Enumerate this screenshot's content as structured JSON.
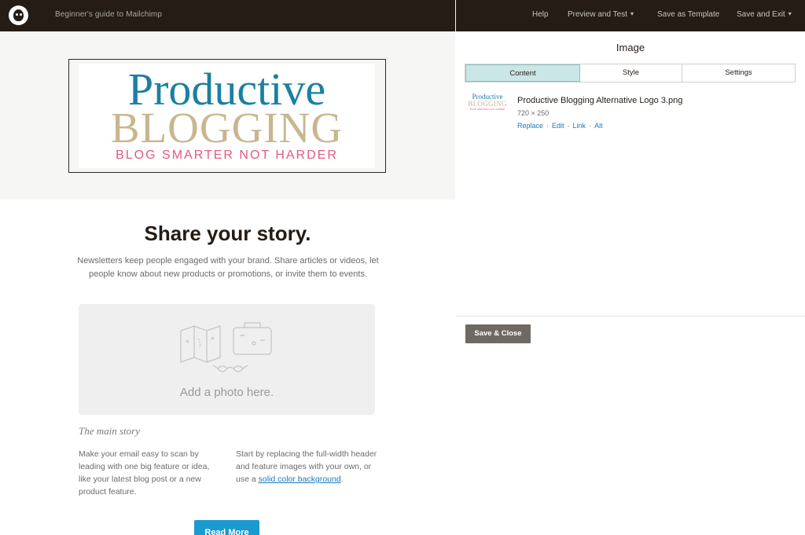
{
  "topbar": {
    "logo_icon": "mailchimp-logo",
    "title": "Beginner's guide to Mailchimp",
    "nav": {
      "help": "Help",
      "preview": "Preview and Test",
      "save_template": "Save as Template",
      "save_exit": "Save and Exit"
    },
    "chevron_icon": "chevron-down-icon",
    "chevron_glyph": "▾"
  },
  "canvas": {
    "header_logo": {
      "line1": "Productive",
      "line2": "BLOGGING",
      "line3": "BLOG SMARTER NOT HARDER",
      "colors": {
        "blue": "#1b7fa3",
        "tan": "#c9b68e",
        "pink": "#e35a7e"
      }
    },
    "story_title": "Share your story.",
    "story_description": "Newsletters keep people engaged with your brand. Share articles or videos, let people know about new products or promotions, or invite them to events.",
    "photo_placeholder": {
      "label": "Add a photo here.",
      "icon": "travel-illustration-icon"
    },
    "main_story_heading": "The main story",
    "left_column": "Make your email easy to scan by leading with one big feature or idea, like your latest blog post or a new product feature.",
    "right_column": {
      "text_before": "Start by replacing the full-width header and feature images with your own, or use a ",
      "link": "solid color background",
      "text_after": "."
    },
    "read_more_button": "Read More",
    "accent_color": "#1a9ad0"
  },
  "panel": {
    "title": "Image",
    "tabs": [
      {
        "label": "Content",
        "active": true
      },
      {
        "label": "Style",
        "active": false
      },
      {
        "label": "Settings",
        "active": false
      }
    ],
    "file": {
      "thumbnail": {
        "line1": "Productive",
        "line2": "BLOGGING",
        "line3": "BLOG SMARTER NOT HARDER"
      },
      "name": "Productive Blogging Alternative Logo 3.png",
      "dimensions": "720 × 250",
      "actions": [
        "Replace",
        "Edit",
        "Link",
        "Alt"
      ],
      "separator": "·"
    },
    "save_close_button": "Save & Close"
  }
}
